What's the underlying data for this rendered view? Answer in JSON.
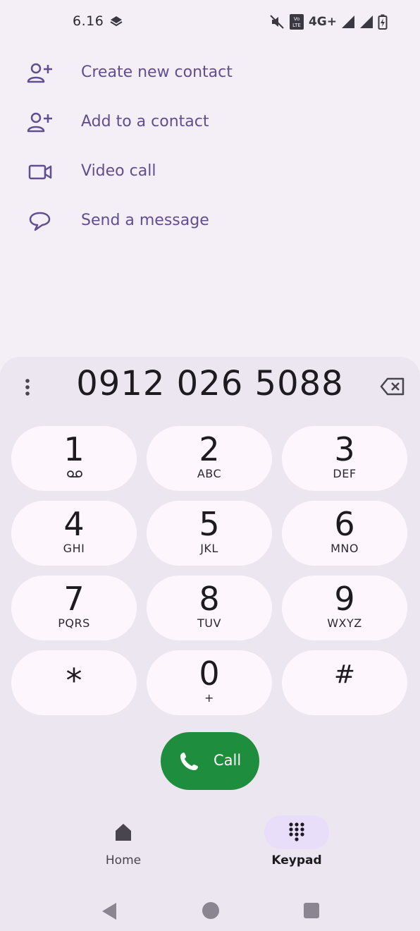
{
  "status_bar": {
    "time": "6.16",
    "network": "4G+",
    "icons": [
      "cloud-stack-icon",
      "mute-icon",
      "volte-icon",
      "signal-icon",
      "signal-icon",
      "battery-charging-icon"
    ]
  },
  "options": [
    {
      "label": "Create new contact",
      "icon": "add-person-icon"
    },
    {
      "label": "Add to a contact",
      "icon": "add-person-icon"
    },
    {
      "label": "Video call",
      "icon": "video-camera-icon"
    },
    {
      "label": "Send a message",
      "icon": "chat-bubble-icon"
    }
  ],
  "dialer": {
    "number": "0912 026 5088",
    "keys": [
      {
        "digit": "1",
        "letters": ""
      },
      {
        "digit": "2",
        "letters": "ABC"
      },
      {
        "digit": "3",
        "letters": "DEF"
      },
      {
        "digit": "4",
        "letters": "GHI"
      },
      {
        "digit": "5",
        "letters": "JKL"
      },
      {
        "digit": "6",
        "letters": "MNO"
      },
      {
        "digit": "7",
        "letters": "PQRS"
      },
      {
        "digit": "8",
        "letters": "TUV"
      },
      {
        "digit": "9",
        "letters": "WXYZ"
      },
      {
        "digit": "*",
        "letters": ""
      },
      {
        "digit": "0",
        "letters": "+"
      },
      {
        "digit": "#",
        "letters": ""
      }
    ],
    "call_label": "Call"
  },
  "bottom_nav": {
    "home_label": "Home",
    "keypad_label": "Keypad"
  },
  "colors": {
    "accent": "#5f4f91",
    "call_green": "#1e8e3e",
    "key_bg": "#fdf7fd",
    "panel_bg": "#ebe6ef",
    "active_pill": "#e8defa"
  }
}
